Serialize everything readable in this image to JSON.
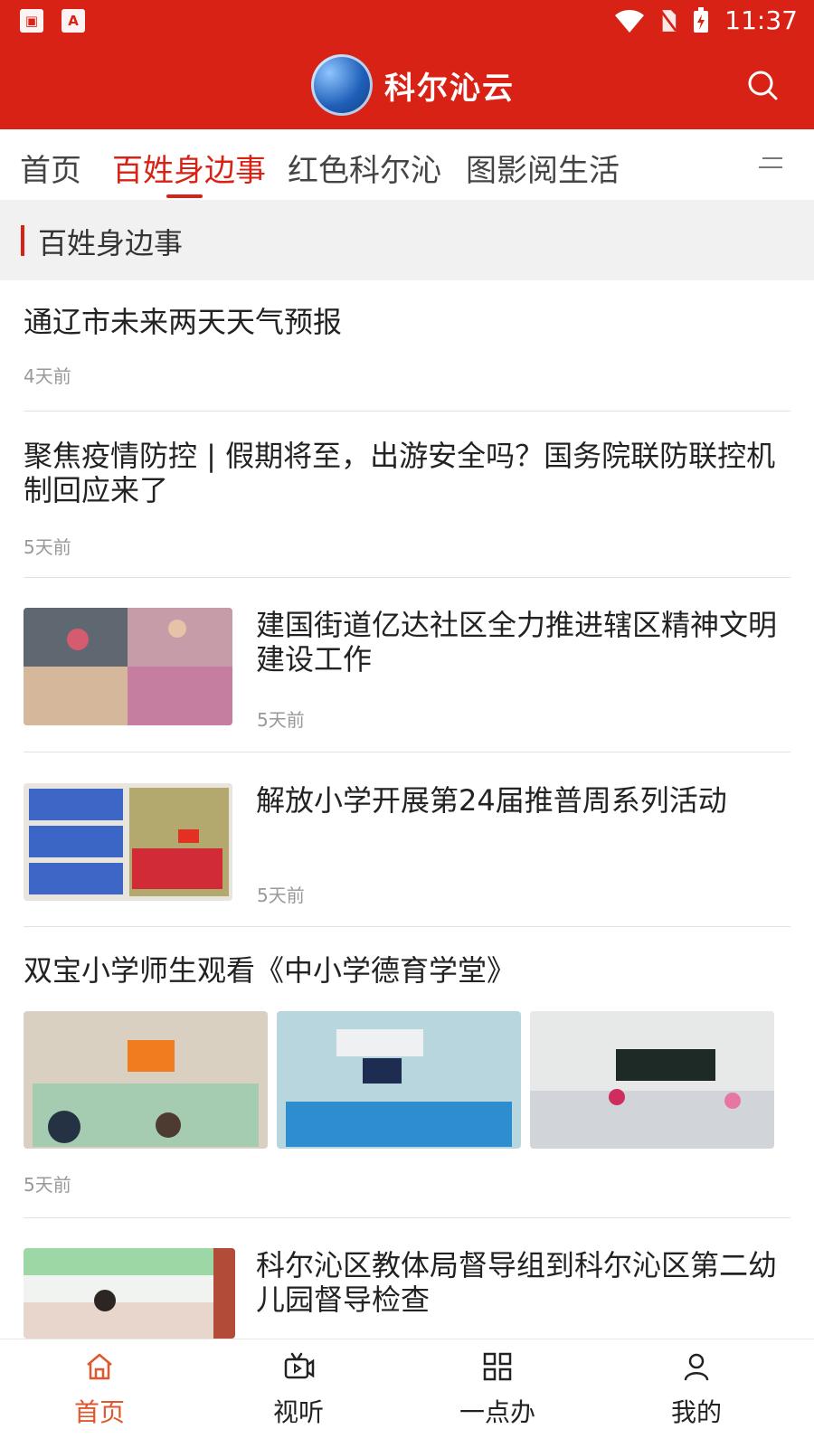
{
  "status": {
    "time": "11:37"
  },
  "header": {
    "app_title": "科尔沁云",
    "search_icon": "search-icon"
  },
  "tabs": [
    {
      "label": "首页",
      "active": false
    },
    {
      "label": "百姓身边事",
      "active": true
    },
    {
      "label": "红色科尔沁",
      "active": false
    },
    {
      "label": "图影阅生活",
      "active": false
    }
  ],
  "section": {
    "title": "百姓身边事"
  },
  "articles": [
    {
      "title": "通辽市未来两天天气预报",
      "time": "4天前"
    },
    {
      "title": "聚焦疫情防控 | 假期将至，出游安全吗？国务院联防联控机制回应来了",
      "time": "5天前"
    },
    {
      "title": "建国街道亿达社区全力推进辖区精神文明建设工作",
      "time": "5天前"
    },
    {
      "title": "解放小学开展第24届推普周系列活动",
      "time": "5天前"
    },
    {
      "title": "双宝小学师生观看《中小学德育学堂》",
      "time": "5天前"
    },
    {
      "title": "科尔沁区教体局督导组到科尔沁区第二幼儿园督导检查",
      "time": ""
    }
  ],
  "bottom_nav": [
    {
      "label": "首页",
      "icon": "home-icon",
      "active": true
    },
    {
      "label": "视听",
      "icon": "video-icon",
      "active": false
    },
    {
      "label": "一点办",
      "icon": "grid-icon",
      "active": false
    },
    {
      "label": "我的",
      "icon": "user-icon",
      "active": false
    }
  ],
  "colors": {
    "brand": "#d82216",
    "active_nav": "#e1562b"
  }
}
